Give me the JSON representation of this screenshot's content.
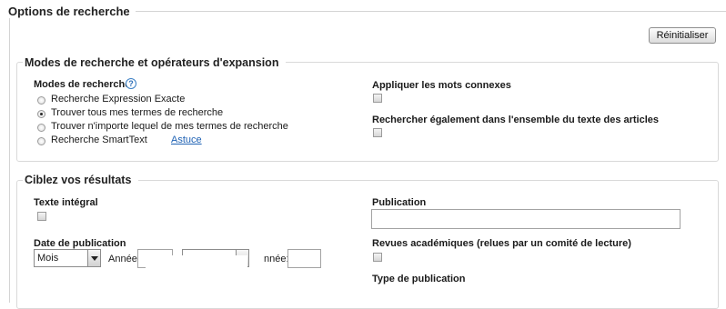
{
  "page": {
    "title": "Options de recherche",
    "reset_label": "Réinitialiser"
  },
  "modes": {
    "legend": "Modes de recherche et opérateurs d'expansion",
    "modes_label": "Modes de recherche",
    "help_glyph": "?",
    "options": [
      {
        "label": "Recherche Expression Exacte",
        "selected": false
      },
      {
        "label": "Trouver tous mes termes de recherche",
        "selected": true
      },
      {
        "label": "Trouver n'importe lequel de mes termes de recherche",
        "selected": false
      },
      {
        "label": "Recherche SmartText",
        "selected": false
      }
    ],
    "tip_link": "Astuce",
    "related_words_label": "Appliquer les mots connexes",
    "related_words_checked": false,
    "fulltext_search_label": "Rechercher également dans l'ensemble du texte des articles",
    "fulltext_search_checked": false
  },
  "results": {
    "legend": "Ciblez vos résultats",
    "full_text_label": "Texte intégral",
    "full_text_checked": false,
    "publication_label": "Publication",
    "publication_value": "",
    "pubdate_label": "Date de publication",
    "month_select_value": "Mois",
    "year_label_1": "Année:",
    "year_label_2": "Année:",
    "year_label_2_visible": "nnée:",
    "peer_reviewed_label": "Revues académiques (relues par un comité de lecture)",
    "peer_reviewed_checked": false,
    "pub_type_label": "Type de publication"
  },
  "colors": {
    "link": "#1f62b4",
    "border": "#d9d9d9"
  }
}
